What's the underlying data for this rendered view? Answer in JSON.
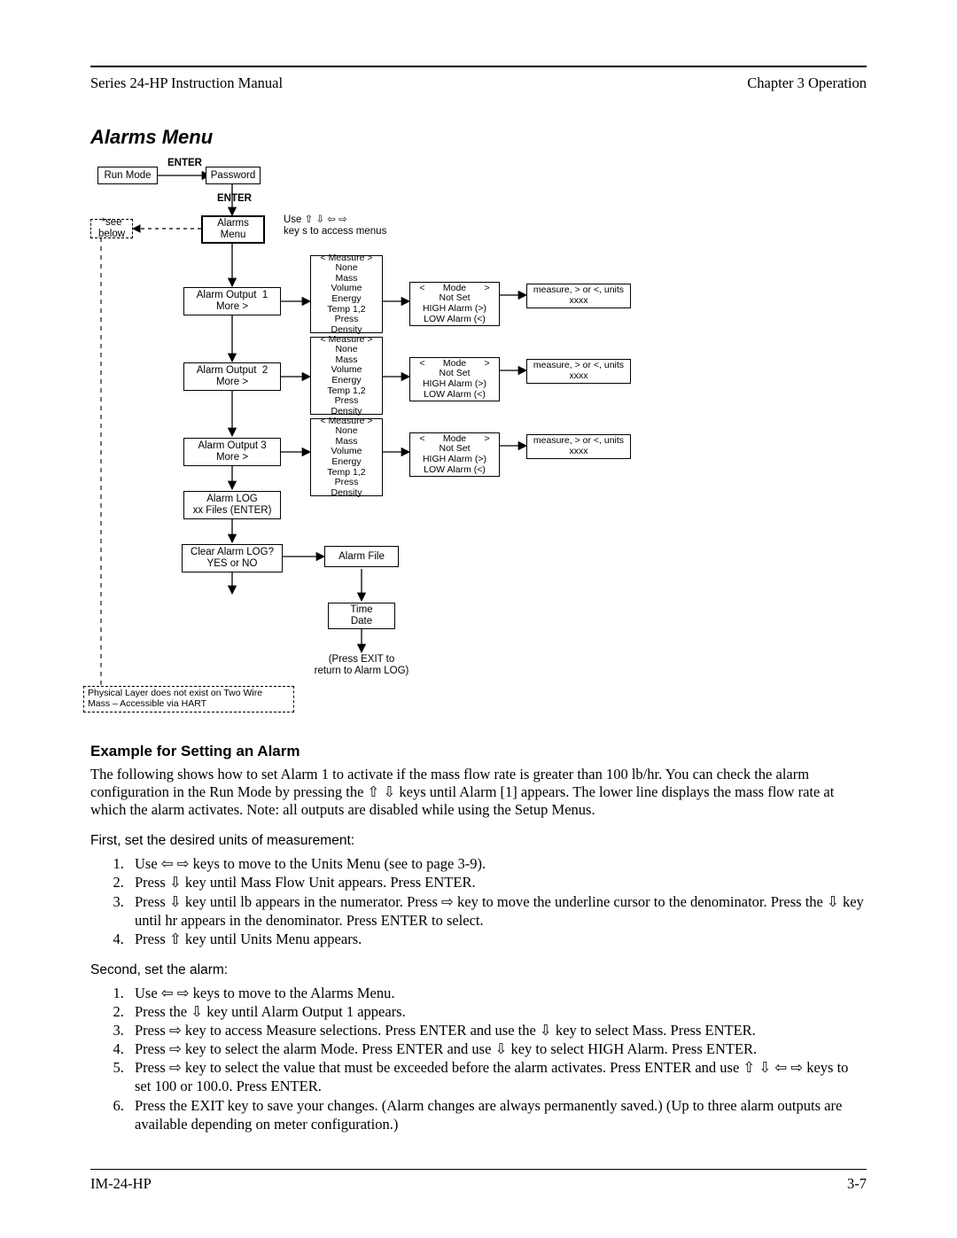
{
  "header": {
    "left": "Series 24-HP Instruction Manual",
    "right": "Chapter 3 Operation"
  },
  "section": {
    "title": "Alarms Menu"
  },
  "diagram": {
    "enter1": "ENTER",
    "enter2": "ENTER",
    "run_mode": "Run Mode",
    "password": "Password",
    "see_below": "*see below",
    "alarms_menu": "Alarms\nMenu",
    "use_keys": "Use ⇧ ⇩ ⇦ ⇨\nkey s to access menus",
    "alarm_output_1": "Alarm Output  1\nMore >",
    "alarm_output_2": "Alarm Output  2\nMore >",
    "alarm_output_3": "Alarm Output 3\nMore >",
    "alarm_log": "Alarm LOG\nxx Files (ENTER)",
    "clear_log": "Clear Alarm LOG?\nYES or NO",
    "measure_box": "< Measure >\nNone\nMass\nVolume\nEnergy\nTemp 1,2\nPress\nDensity",
    "mode_box": "<       Mode       >\nNot Set\nHIGH Alarm (>)\nLOW Alarm (<)",
    "units_box": "measure, > or <, units\nxxxx",
    "alarm_file": "Alarm File",
    "time_date": "Time\nDate",
    "exit_note": "(Press EXIT to\nreturn to Alarm LOG)",
    "phys_note": "Physical Layer does not exist on Two Wire\nMass – Accessible via HART"
  },
  "example": {
    "title": "Example for Setting an Alarm",
    "intro": "The following shows how to set Alarm 1 to activate if the mass flow rate is greater than 100 lb/hr. You can check the alarm configuration in the Run Mode by pressing the ⇧ ⇩ keys until Alarm [1] appears. The lower line displays the mass flow rate at which the alarm activates. Note: all outputs are disabled while using the Setup Menus.",
    "first_lead": "First, set the desired units of measurement:",
    "first_steps": [
      "Use ⇦ ⇨ keys to move to the Units Menu (see to page 3-9).",
      "Press ⇩ key until Mass Flow Unit appears. Press ENTER.",
      "Press ⇩ key until lb appears in the numerator. Press ⇨ key to move the underline cursor to the denominator. Press the ⇩ key until hr appears in the denominator. Press ENTER to select.",
      "Press ⇧ key until Units Menu appears."
    ],
    "second_lead": "Second, set the alarm:",
    "second_steps": [
      "Use ⇦ ⇨ keys to move to the Alarms Menu.",
      "Press the ⇩ key until Alarm Output 1 appears.",
      "Press ⇨ key to access Measure selections. Press ENTER and use the ⇩ key to select Mass. Press ENTER.",
      "Press ⇨ key to select the alarm Mode. Press ENTER and use ⇩ key to select HIGH Alarm. Press ENTER.",
      "Press ⇨ key to select the value that must be exceeded before the alarm activates. Press ENTER and use ⇧ ⇩ ⇦ ⇨ keys to set 100 or 100.0. Press ENTER.",
      "Press the EXIT key to save your changes. (Alarm changes are always permanently saved.) (Up to three alarm outputs are available depending on meter configuration.)"
    ]
  },
  "footer": {
    "left": "IM-24-HP",
    "right": "3-7"
  }
}
